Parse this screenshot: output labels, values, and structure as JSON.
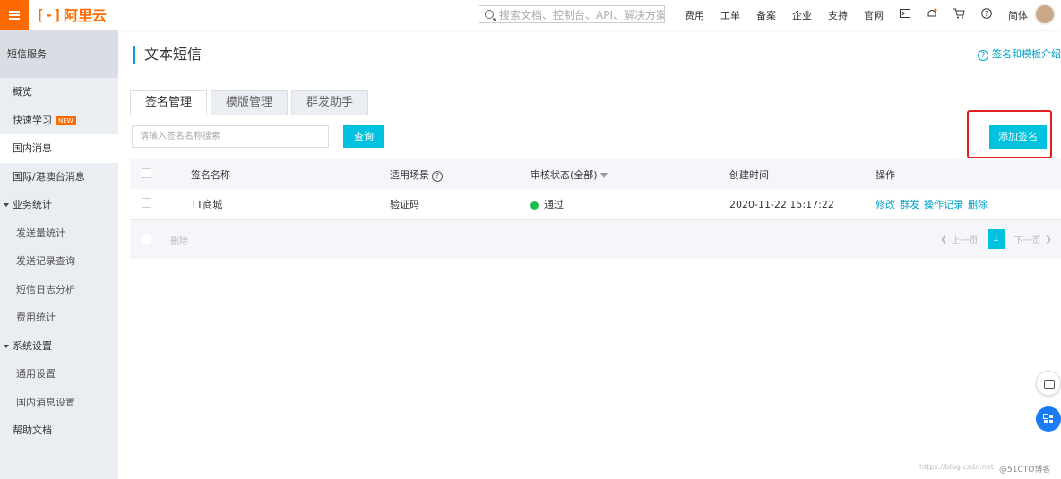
{
  "topbar": {
    "menu_icon": "hamburger-icon",
    "logo_text": "阿里云",
    "search_placeholder": "搜索文档、控制台、API、解决方案",
    "nav": [
      "费用",
      "工单",
      "备案",
      "企业",
      "支持",
      "官网"
    ],
    "icons": [
      "terminal-icon",
      "bell-icon",
      "cart-icon",
      "help-icon"
    ],
    "lang": "简体",
    "accent_color": "#ff6a00"
  },
  "sidebar": {
    "title": "短信服务",
    "items": [
      {
        "label": "概览",
        "type": "item"
      },
      {
        "label": "快速学习",
        "type": "item",
        "badge": "NEW"
      },
      {
        "label": "国内消息",
        "type": "item",
        "active": true
      },
      {
        "label": "国际/港澳台消息",
        "type": "item"
      },
      {
        "label": "业务统计",
        "type": "group"
      },
      {
        "label": "发送量统计",
        "type": "sub"
      },
      {
        "label": "发送记录查询",
        "type": "sub"
      },
      {
        "label": "短信日志分析",
        "type": "sub"
      },
      {
        "label": "费用统计",
        "type": "sub"
      },
      {
        "label": "系统设置",
        "type": "group"
      },
      {
        "label": "通用设置",
        "type": "sub"
      },
      {
        "label": "国内消息设置",
        "type": "sub"
      },
      {
        "label": "帮助文档",
        "type": "item"
      }
    ]
  },
  "main": {
    "title": "文本短信",
    "help_link": "签名和模板介绍",
    "tabs": [
      {
        "label": "签名管理",
        "active": true
      },
      {
        "label": "模版管理",
        "active": false
      },
      {
        "label": "群发助手",
        "active": false
      }
    ],
    "search_placeholder": "请输入签名名称搜索",
    "query_button": "查询",
    "add_button": "添加签名",
    "table": {
      "headers": [
        "签名名称",
        "适用场景",
        "审核状态(全部)",
        "创建时间",
        "操作"
      ],
      "rows": [
        {
          "name": "TT商城",
          "scene": "验证码",
          "status": "通过",
          "created": "2020-11-22 15:17:22",
          "actions": [
            "修改",
            "群发",
            "操作记录",
            "删除"
          ]
        }
      ],
      "footer_delete": "删除",
      "pager": {
        "prev": "上一页",
        "page": "1",
        "next": "下一页"
      }
    },
    "status_color": "#1ebd4a",
    "primary_color": "#00c1de"
  },
  "watermark": {
    "url": "https://blog.csdn.net",
    "brand": "@51CTO博客"
  }
}
